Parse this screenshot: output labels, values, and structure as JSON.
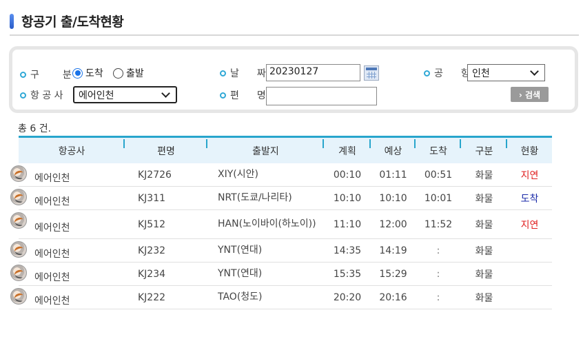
{
  "page": {
    "title": "항공기 출/도착현황"
  },
  "search": {
    "category_label": "구　분",
    "radio_arrival": "도착",
    "radio_departure": "출발",
    "date_label": "날　짜",
    "date_value": "20230127",
    "airport_label": "공　항",
    "airport_value": "인천",
    "airline_label": "항 공 사",
    "airline_value": "에어인천",
    "flight_label": "편　명",
    "flight_value": "",
    "search_button": "› 검색"
  },
  "summary": {
    "count_text": "총 6 건."
  },
  "table": {
    "headers": [
      "항공사",
      "편명",
      "출발지",
      "계획",
      "예상",
      "도착",
      "구분",
      "현황"
    ],
    "rows": [
      {
        "airline": "에어인천",
        "flight": "KJ2726",
        "origin": "XIY(시안)",
        "planned": "00:10",
        "estimated": "01:11",
        "arrived": "00:51",
        "type": "화물",
        "status": "지연",
        "status_kind": "delay"
      },
      {
        "airline": "에어인천",
        "flight": "KJ311",
        "origin": "NRT(도쿄/나리타)",
        "planned": "10:10",
        "estimated": "10:10",
        "arrived": "10:01",
        "type": "화물",
        "status": "도착",
        "status_kind": "arrived"
      },
      {
        "airline": "에어인천",
        "flight": "KJ512",
        "origin": "HAN(노이바이(하노이))",
        "planned": "11:10",
        "estimated": "12:00",
        "arrived": "11:52",
        "type": "화물",
        "status": "지연",
        "status_kind": "delay"
      },
      {
        "airline": "에어인천",
        "flight": "KJ232",
        "origin": "YNT(연대)",
        "planned": "14:35",
        "estimated": "14:19",
        "arrived": ":",
        "type": "화물",
        "status": "",
        "status_kind": "none"
      },
      {
        "airline": "에어인천",
        "flight": "KJ234",
        "origin": "YNT(연대)",
        "planned": "15:35",
        "estimated": "15:29",
        "arrived": ":",
        "type": "화물",
        "status": "",
        "status_kind": "none"
      },
      {
        "airline": "에어인천",
        "flight": "KJ222",
        "origin": "TAO(청도)",
        "planned": "20:20",
        "estimated": "20:16",
        "arrived": ":",
        "type": "화물",
        "status": "",
        "status_kind": "none"
      }
    ]
  },
  "colors": {
    "accent": "#27a5cc",
    "delay": "#e02020",
    "arrived": "#1a2aa8",
    "header_bg": "#e6f3fb"
  }
}
